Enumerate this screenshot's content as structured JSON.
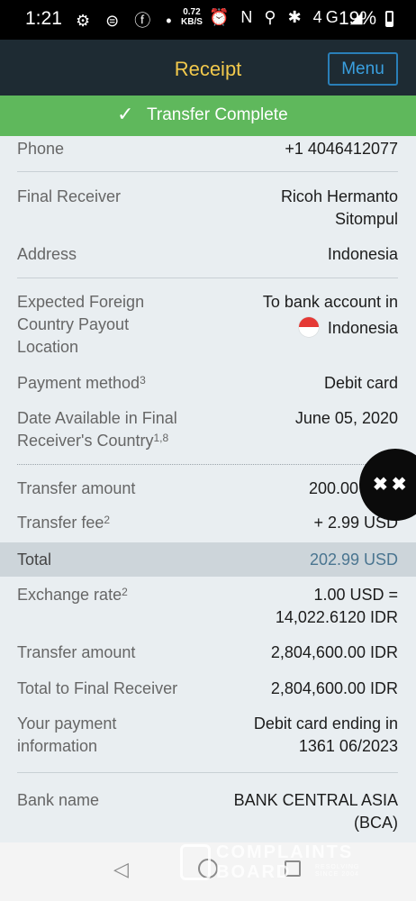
{
  "status_bar": {
    "time": "1:21",
    "left_icons": "⚙ ⊜ ⓕ •",
    "net_speed": "0.72",
    "net_unit": "KB/S",
    "right_icons": "⏰ N ⚲ ✱ 4G ◢",
    "battery": "19%"
  },
  "header": {
    "title": "Receipt",
    "menu_label": "Menu"
  },
  "banner": {
    "icon": "check-icon",
    "text": "Transfer Complete"
  },
  "receipt": {
    "phone": {
      "label": "Phone",
      "value": "+1 4046412077"
    },
    "final_receiver": {
      "label": "Final Receiver",
      "value_line1": "Ricoh Hermanto",
      "value_line2": "Sitompul"
    },
    "address": {
      "label": "Address",
      "value": "Indonesia"
    },
    "payout_location": {
      "label_line1": "Expected Foreign",
      "label_line2": "Country Payout",
      "label_line3": "Location",
      "value_line1": "To bank account in",
      "value_line2": "Indonesia"
    },
    "payment_method": {
      "label": "Payment method",
      "sup": "3",
      "value": "Debit card"
    },
    "date_available": {
      "label_line1": "Date Available in Final",
      "label_line2": "Receiver's Country",
      "sup": "1,8",
      "value": "June 05, 2020"
    },
    "transfer_amount_usd": {
      "label": "Transfer amount",
      "value": "200.00"
    },
    "transfer_fee": {
      "label": "Transfer fee",
      "sup": "2",
      "value": "+ 2.99 USD"
    },
    "total": {
      "label": "Total",
      "value": "202.99 USD"
    },
    "exchange_rate": {
      "label": "Exchange rate",
      "sup": "2",
      "value_line1": "1.00 USD =",
      "value_line2": "14,022.6120 IDR"
    },
    "transfer_amount_idr": {
      "label": "Transfer amount",
      "value": "2,804,600.00 IDR"
    },
    "total_to_receiver": {
      "label": "Total to Final Receiver",
      "value": "2,804,600.00 IDR"
    },
    "payment_info": {
      "label_line1": "Your payment",
      "label_line2": "information",
      "value_line1": "Debit card ending in",
      "value_line2": "1361 06/2023"
    },
    "bank_name": {
      "label": "Bank name",
      "value_line1": "BANK CENTRAL ASIA",
      "value_line2": "(BCA)"
    }
  },
  "colors": {
    "header_bg": "#1e2b33",
    "title": "#f2c94c",
    "menu": "#3aa0e0",
    "banner": "#5fb85c",
    "total_value": "#4a7590"
  },
  "watermark": {
    "line1": "COMPLAINTS",
    "line2": "BOARD",
    "small": "RESOLVING SINCE 2004"
  }
}
